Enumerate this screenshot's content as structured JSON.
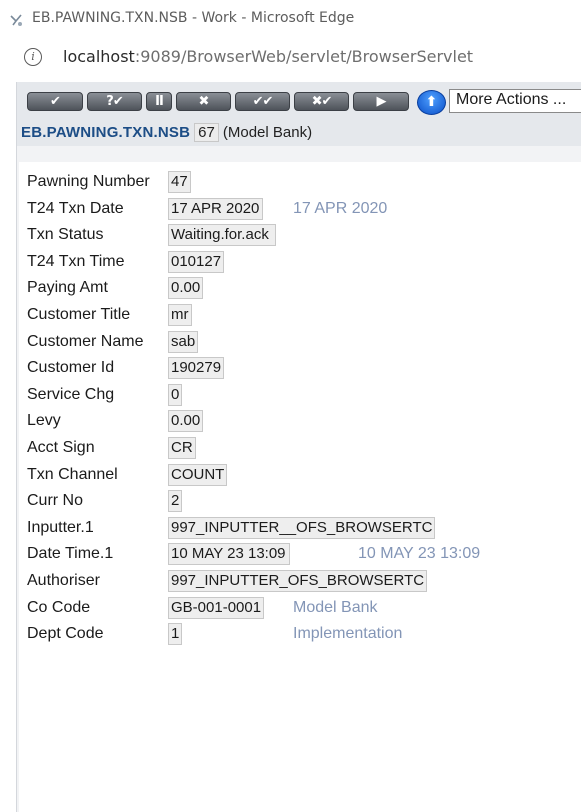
{
  "window": {
    "title": "EB.PAWNING.TXN.NSB - Work - Microsoft Edge",
    "url_host": "localhost",
    "url_path": ":9089/BrowserWeb/servlet/BrowserServlet"
  },
  "toolbar": {
    "buttons": [
      {
        "name": "commit-button",
        "label": "✔"
      },
      {
        "name": "validate-button",
        "label": "?✔"
      },
      {
        "name": "hold-button",
        "label": "II"
      },
      {
        "name": "delete-button",
        "label": "✖"
      },
      {
        "name": "authorise-button",
        "label": "✔✔"
      },
      {
        "name": "reverse-button",
        "label": "✖✔"
      },
      {
        "name": "next-button",
        "label": "▶"
      }
    ],
    "more_actions": "More Actions ..."
  },
  "screen": {
    "app_name": "EB.PAWNING.TXN.NSB",
    "record_id": "67",
    "company": "(Model Bank)"
  },
  "fields": [
    {
      "label": "Pawning Number",
      "value": "47",
      "enrichment": ""
    },
    {
      "label": "T24 Txn Date",
      "value": "17 APR 2020",
      "enrichment": "17 APR 2020"
    },
    {
      "label": "Txn Status",
      "value": "Waiting.for.ack",
      "enrichment": ""
    },
    {
      "label": "T24 Txn Time",
      "value": "010127",
      "enrichment": ""
    },
    {
      "label": "Paying Amt",
      "value": "0.00",
      "enrichment": ""
    },
    {
      "label": "Customer Title",
      "value": "mr",
      "enrichment": ""
    },
    {
      "label": "Customer Name",
      "value": "sab",
      "enrichment": ""
    },
    {
      "label": "Customer Id",
      "value": "190279",
      "enrichment": ""
    },
    {
      "label": "Service Chg",
      "value": "0",
      "enrichment": ""
    },
    {
      "label": "Levy",
      "value": "0.00",
      "enrichment": ""
    },
    {
      "label": "Acct Sign",
      "value": "CR",
      "enrichment": ""
    },
    {
      "label": "Txn Channel",
      "value": "COUNT",
      "enrichment": ""
    },
    {
      "label": "Curr No",
      "value": "2",
      "enrichment": ""
    },
    {
      "label": "Inputter.1",
      "value": "997_INPUTTER__OFS_BROWSERTC",
      "enrichment": ""
    },
    {
      "label": "Date Time.1",
      "value": "10 MAY 23 13:09",
      "enrichment": "10 MAY 23 13:09"
    },
    {
      "label": "Authoriser",
      "value": "997_INPUTTER_OFS_BROWSERTC",
      "enrichment": ""
    },
    {
      "label": "Co Code",
      "value": "GB-001-0001",
      "enrichment": "Model Bank"
    },
    {
      "label": "Dept Code",
      "value": "1",
      "enrichment": "Implementation"
    }
  ]
}
